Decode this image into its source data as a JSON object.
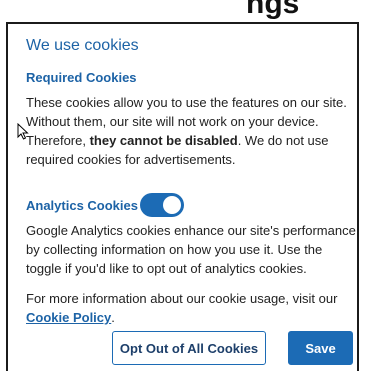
{
  "backdrop": {
    "partial_text": "ngs"
  },
  "dialog": {
    "title": "We use cookies",
    "required": {
      "heading": "Required Cookies",
      "text_part1": "These cookies allow you to use the features on our site. Without them, our site will not work on your device. Therefore, ",
      "text_bold": "they cannot be disabled",
      "text_part2": ". We do not use required cookies for advertisements."
    },
    "analytics": {
      "heading": "Analytics Cookies",
      "toggle_state": "on",
      "text": "Google Analytics cookies enhance our site's performance by collecting information on how you use it. Use the toggle if you'd like to opt out of analytics cookies."
    },
    "more_info": {
      "text": "For more information about our cookie usage, visit our ",
      "link_label": "Cookie Policy",
      "trailing": "."
    },
    "buttons": {
      "opt_out_label": "Opt Out of All Cookies",
      "save_label": "Save"
    }
  },
  "colors": {
    "accent": "#1c6bb5",
    "heading": "#1d63a6",
    "text": "#222222"
  },
  "icons": {
    "cursor": "mouse-pointer-icon"
  }
}
